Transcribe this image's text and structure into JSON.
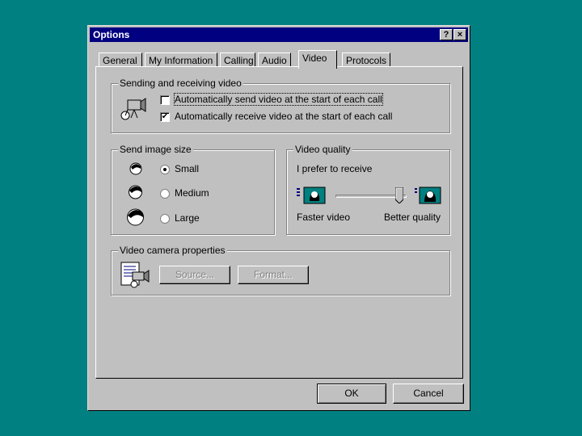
{
  "window": {
    "title": "Options",
    "help_label": "?",
    "close_label": "×"
  },
  "tabs": [
    {
      "label": "General",
      "active": false
    },
    {
      "label": "My Information",
      "active": false
    },
    {
      "label": "Calling",
      "active": false
    },
    {
      "label": "Audio",
      "active": false
    },
    {
      "label": "Video",
      "active": true
    },
    {
      "label": "Protocols",
      "active": false
    }
  ],
  "sending": {
    "legend": "Sending and receiving video",
    "auto_send_label": "Automatically send video at the start of each call",
    "auto_send_checked": false,
    "auto_receive_label": "Automatically receive video at the start of each call",
    "auto_receive_checked": true
  },
  "image_size": {
    "legend": "Send image size",
    "options": [
      {
        "label": "Small",
        "selected": true
      },
      {
        "label": "Medium",
        "selected": false
      },
      {
        "label": "Large",
        "selected": false
      }
    ]
  },
  "quality": {
    "legend": "Video quality",
    "prompt": "I prefer to receive",
    "left_label": "Faster video",
    "right_label": "Better quality",
    "slider_position": 0.9
  },
  "camera": {
    "legend": "Video camera properties",
    "source_label": "Source...",
    "format_label": "Format..."
  },
  "footer": {
    "ok_label": "OK",
    "cancel_label": "Cancel"
  }
}
